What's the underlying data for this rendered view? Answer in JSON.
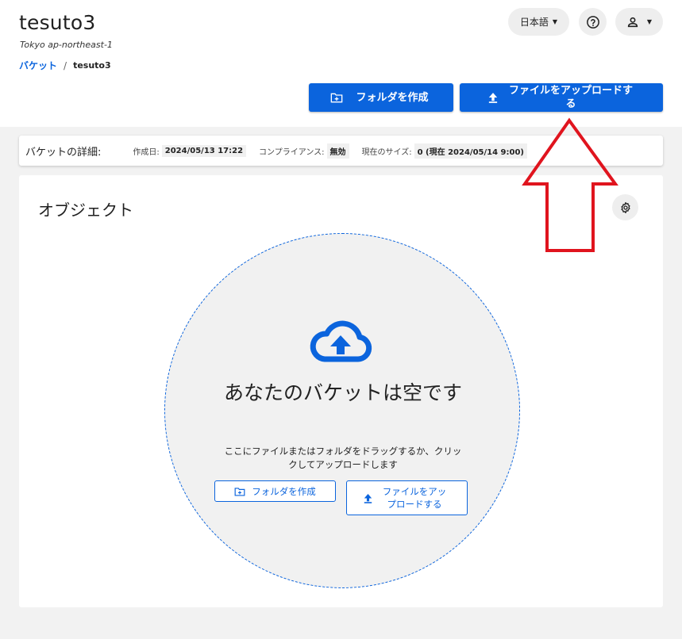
{
  "header": {
    "title": "tesuto3",
    "region": "Tokyo ap-northeast-1",
    "language": "日本語"
  },
  "breadcrumb": {
    "root": "バケット",
    "separator": "/",
    "current": "tesuto3"
  },
  "actions": {
    "create_folder": "フォルダを作成",
    "upload_files": "ファイルをアップロードする"
  },
  "details": {
    "heading": "バケットの詳細:",
    "created_label": "作成日:",
    "created_value": "2024/05/13 17:22",
    "compliance_label": "コンプライアンス:",
    "compliance_value": "無効",
    "size_label": "現在のサイズ:",
    "size_value": "0 (現在 2024/05/14 9:00)"
  },
  "objects": {
    "title": "オブジェクト",
    "empty_title": "あなたのバケットは空です",
    "empty_hint": "ここにファイルまたはフォルダをドラッグするか、クリックしてアップロードします",
    "create_folder": "フォルダを作成",
    "upload_files": "ファイルをアップロードする"
  },
  "colors": {
    "accent": "#0b64dd",
    "annotation_arrow": "#e0141e"
  },
  "icons": [
    "chevron-down-icon",
    "help-icon",
    "user-icon",
    "folder-plus-icon",
    "upload-icon",
    "gear-icon",
    "cloud-upload-icon",
    "annotation-arrow-up-icon"
  ]
}
